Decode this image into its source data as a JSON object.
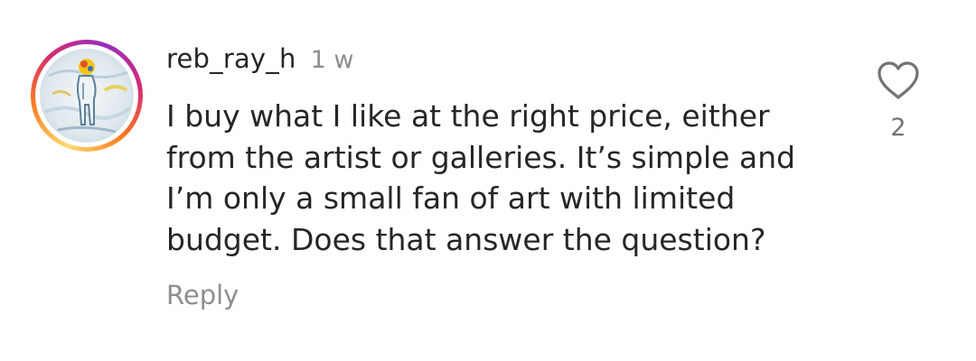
{
  "comment": {
    "username": "reb_ray_h",
    "timestamp": "1 w",
    "text": "I buy what I like at the right price, either from the artist or galleries. It’s simple and I’m only a small fan of art with limited budget. Does that answer the question?",
    "reply_label": "Reply",
    "like_count": "2",
    "like_icon": "heart-outline-icon",
    "avatar_ring_colors": [
      "#feda75",
      "#fa7e1e",
      "#d62976",
      "#962fbf"
    ]
  }
}
